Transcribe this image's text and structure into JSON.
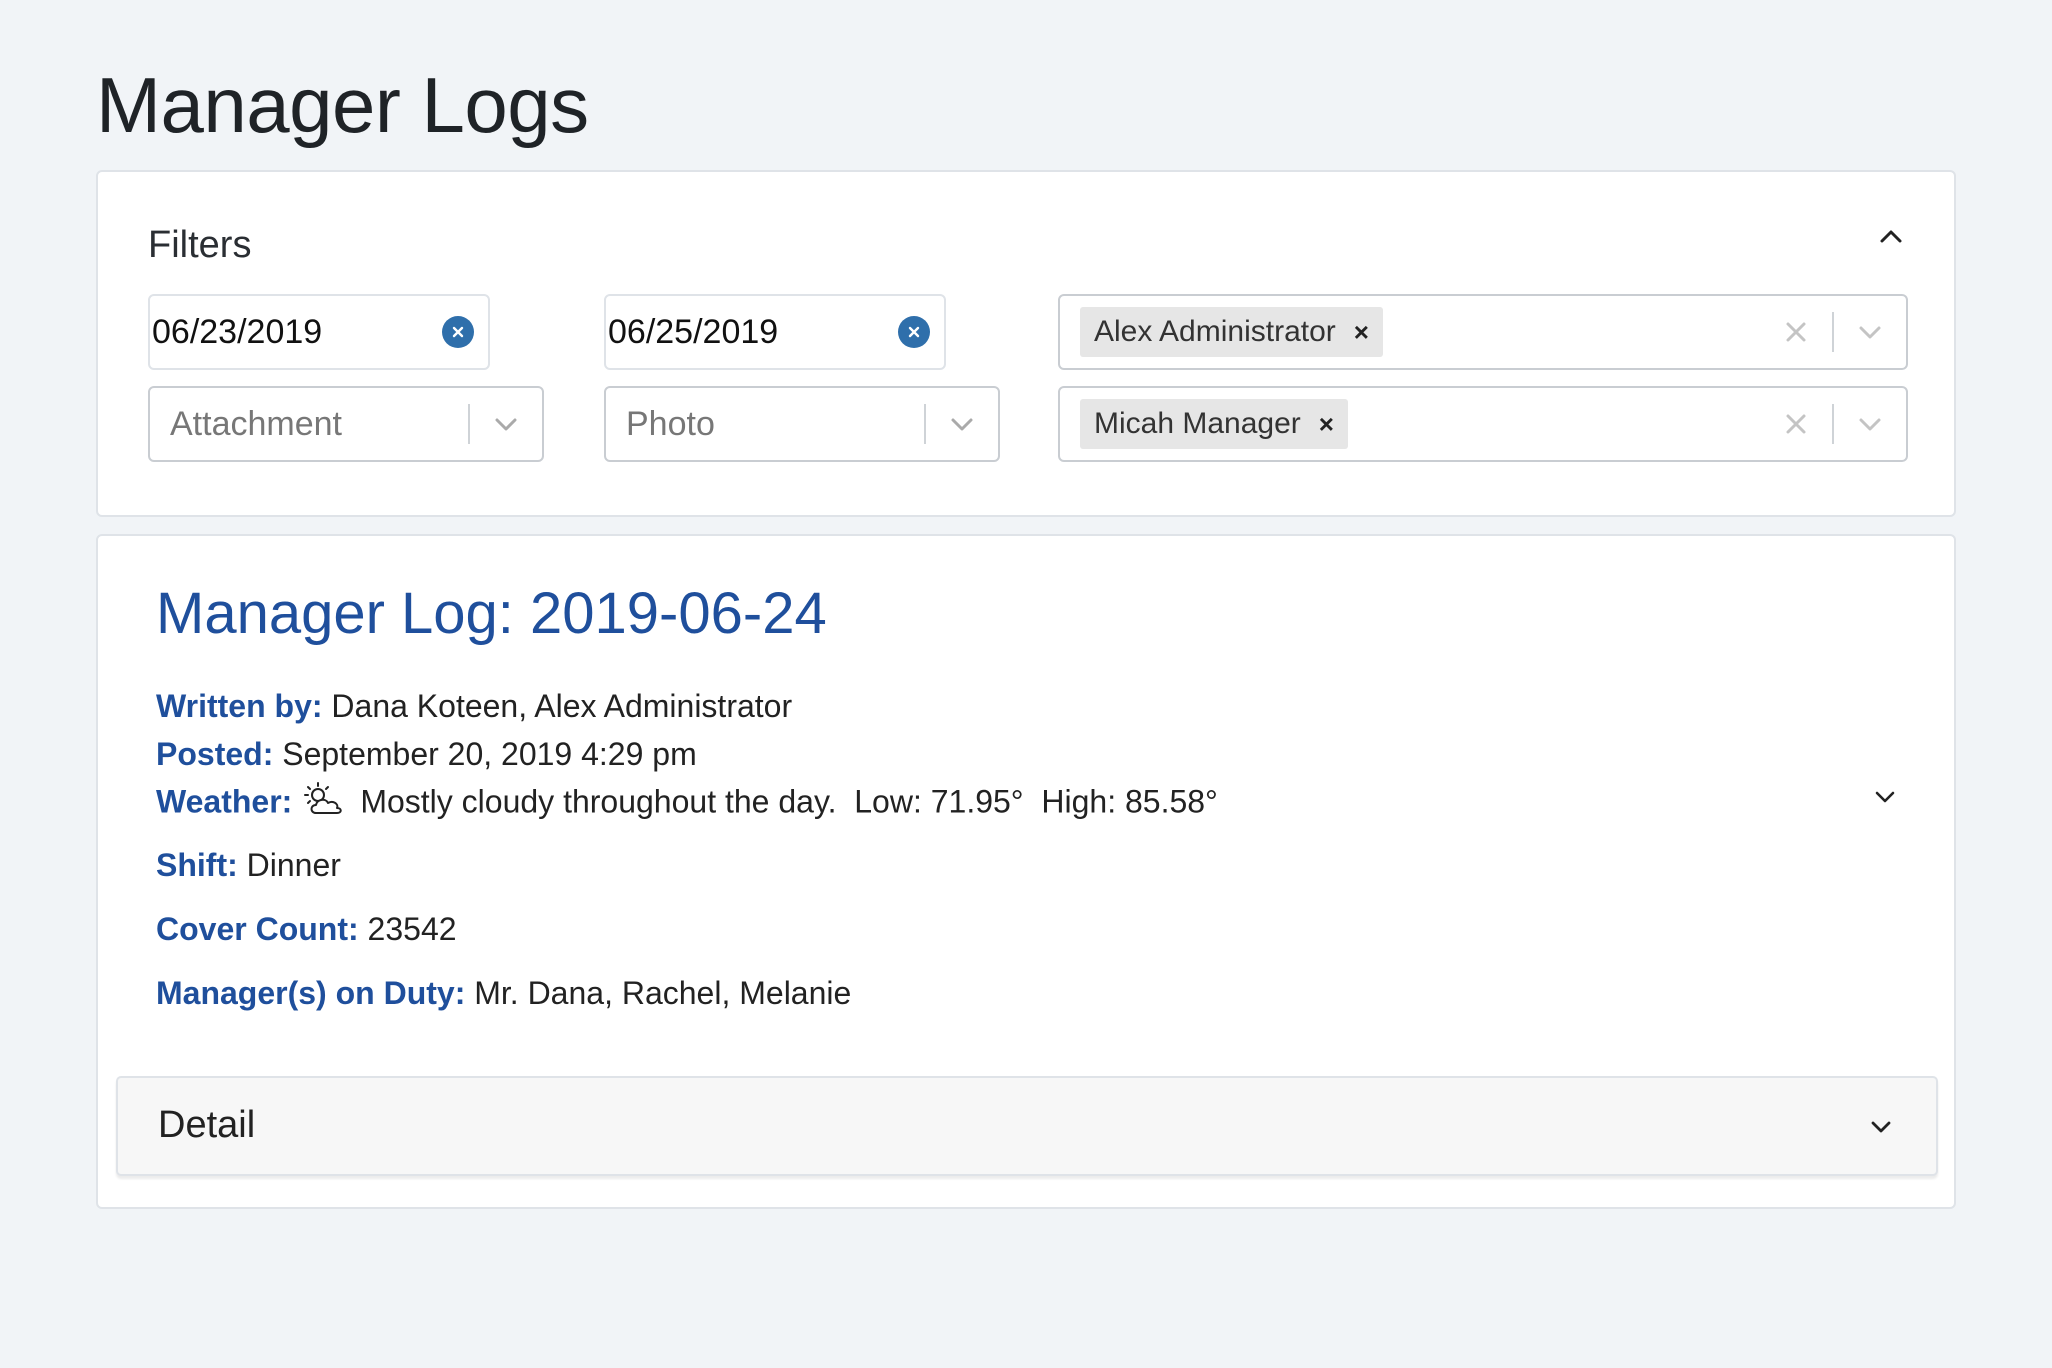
{
  "page": {
    "title": "Manager Logs"
  },
  "filters": {
    "title": "Filters",
    "start_date": "06/23/2019",
    "end_date": "06/25/2019",
    "attachment_placeholder": "Attachment",
    "photo_placeholder": "Photo",
    "written_by_chip": "Alex Administrator",
    "manager_chip": "Micah Manager",
    "remove_glyph": "×"
  },
  "log": {
    "title": "Manager Log: 2019-06-24",
    "written_by_label": "Written by:",
    "written_by": "Dana Koteen, Alex Administrator",
    "posted_label": "Posted:",
    "posted": "September 20, 2019 4:29 pm",
    "weather_label": "Weather:",
    "weather_icon": "partly-cloudy-icon",
    "weather_text": "Mostly cloudy throughout the day.",
    "low": "Low: 71.95°",
    "high": "High: 85.58°",
    "shift_label": "Shift:",
    "shift": "Dinner",
    "cover_label": "Cover Count:",
    "cover": "23542",
    "managers_label": "Manager(s) on Duty:",
    "managers": "Mr. Dana, Rachel, Melanie",
    "detail_label": "Detail"
  },
  "colors": {
    "accent_blue": "#1f4f9c",
    "clear_button": "#2f6fab",
    "background": "#f1f4f7"
  }
}
